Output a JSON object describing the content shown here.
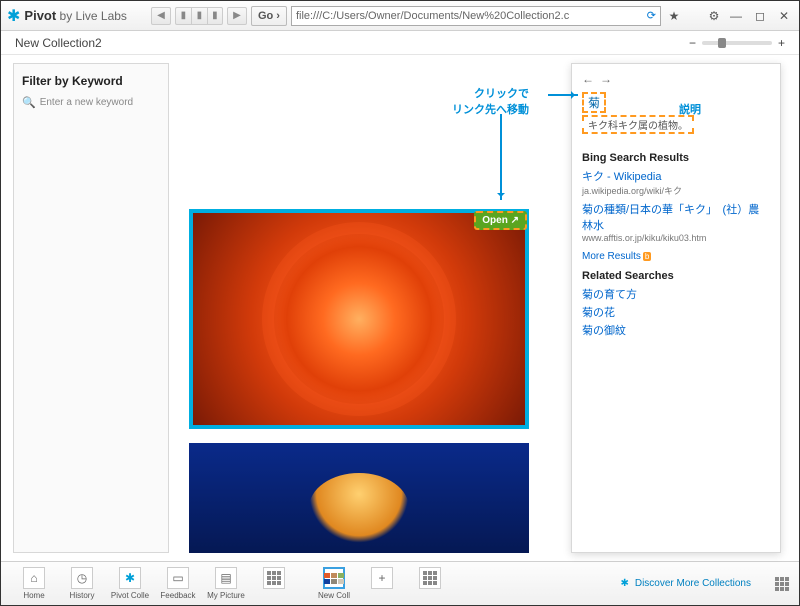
{
  "app": {
    "name": "Pivot",
    "byline": "by Live Labs"
  },
  "toolbar": {
    "go": "Go ›",
    "url": "file:///C:/Users/Owner/Documents/New%20Collection2.c"
  },
  "page": {
    "title": "New Collection2"
  },
  "zoom": {
    "minus": "−",
    "plus": "+"
  },
  "sidebar": {
    "heading": "Filter by Keyword",
    "placeholder": "Enter a new keyword"
  },
  "tile": {
    "open_label": "Open ↗"
  },
  "annotations": {
    "click_link": "クリックで\nリンク先へ移動",
    "explain": "説明"
  },
  "panel": {
    "nav_back": "←",
    "nav_fwd": "→",
    "title": "菊",
    "desc": "キク科キク属の植物。",
    "bing_heading": "Bing Search Results",
    "results": [
      {
        "title": "キク - Wikipedia",
        "src": "ja.wikipedia.org/wiki/キク"
      },
      {
        "title": "菊の種類/日本の華「キク」　(社）農林水",
        "src": "www.afftis.or.jp/kiku/kiku03.htm"
      }
    ],
    "more": "More Results",
    "related_heading": "Related Searches",
    "related": [
      "菊の育て方",
      "菊の花",
      "菊の御紋"
    ]
  },
  "bottom": {
    "items": [
      {
        "label": "Home"
      },
      {
        "label": "History"
      },
      {
        "label": "Pivot Colle"
      },
      {
        "label": "Feedback"
      },
      {
        "label": "My Picture"
      }
    ],
    "active": "New Coll",
    "plus": "+",
    "discover": "Discover More Collections"
  }
}
